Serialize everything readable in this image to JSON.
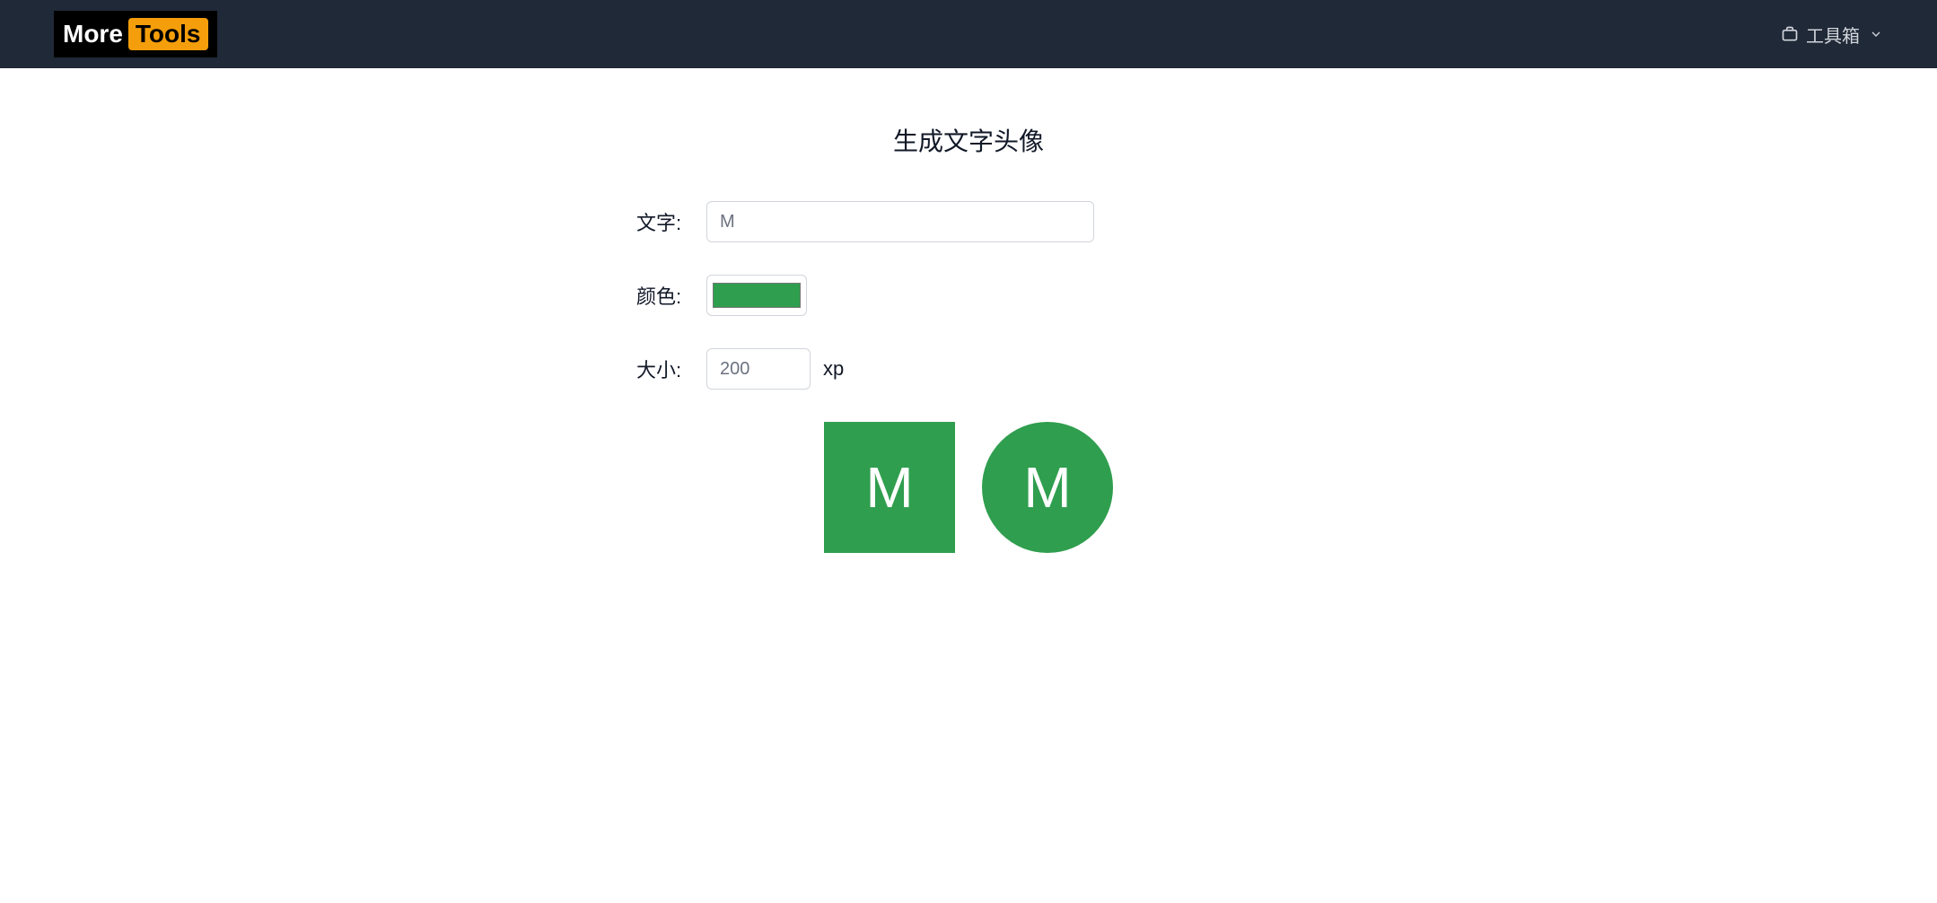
{
  "header": {
    "logo_left": "More",
    "logo_right": "Tools",
    "nav_item": "工具箱"
  },
  "main": {
    "title": "生成文字头像",
    "form": {
      "text_label": "文字:",
      "text_value": "M",
      "color_label": "颜色:",
      "color_value": "#2F9E4E",
      "size_label": "大小:",
      "size_value": "200",
      "size_unit": "xp"
    },
    "preview": {
      "avatar_text": "M",
      "avatar_color": "#2F9E4E"
    }
  }
}
